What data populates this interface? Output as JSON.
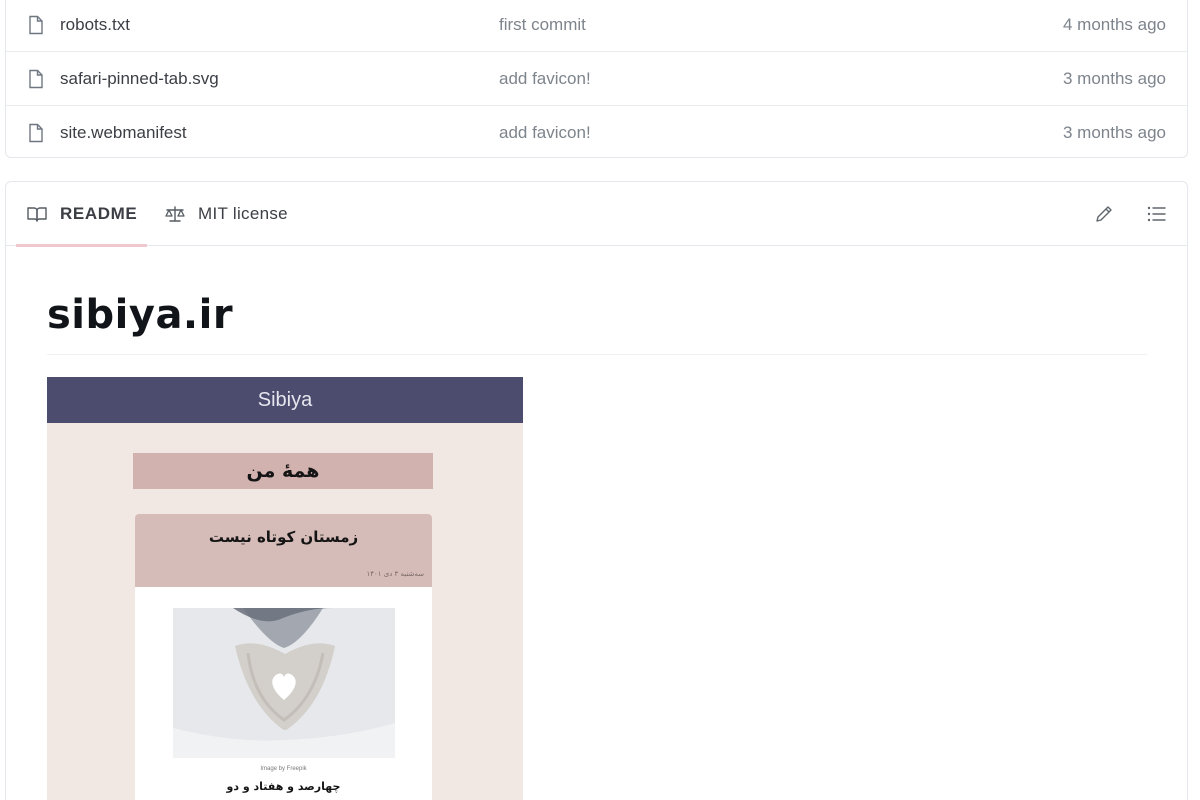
{
  "files": [
    {
      "name": "robots.txt",
      "icon": "file-icon",
      "commit": "first commit",
      "time": "4 months ago"
    },
    {
      "name": "safari-pinned-tab.svg",
      "icon": "file-icon",
      "commit": "add favicon!",
      "time": "3 months ago"
    },
    {
      "name": "site.webmanifest",
      "icon": "file-icon",
      "commit": "add favicon!",
      "time": "3 months ago"
    }
  ],
  "readme": {
    "tabs": [
      {
        "label": "README",
        "icon": "book-icon",
        "active": true
      },
      {
        "label": "MIT license",
        "icon": "scale-icon",
        "active": false
      }
    ],
    "tools": [
      "pencil-icon",
      "list-icon"
    ],
    "title": "sibiya.ir",
    "preview": {
      "brand": "Sibiya",
      "section_title": "همهٔ من",
      "post_title": "زمستان کوتاه نیست",
      "post_meta": "سه‌شنبه ۳ دی ۱۴۰۱",
      "image_credit": "Image by Freepik",
      "caption": "چهارصد و هفتاد و دو"
    }
  },
  "colors": {
    "active_tab_underline": "#f0c9d0",
    "preview_header": "#4b4c6e",
    "preview_background": "#f2e8e3",
    "preview_section": "#d2b2ae",
    "preview_card_head": "#d6bcb8"
  }
}
